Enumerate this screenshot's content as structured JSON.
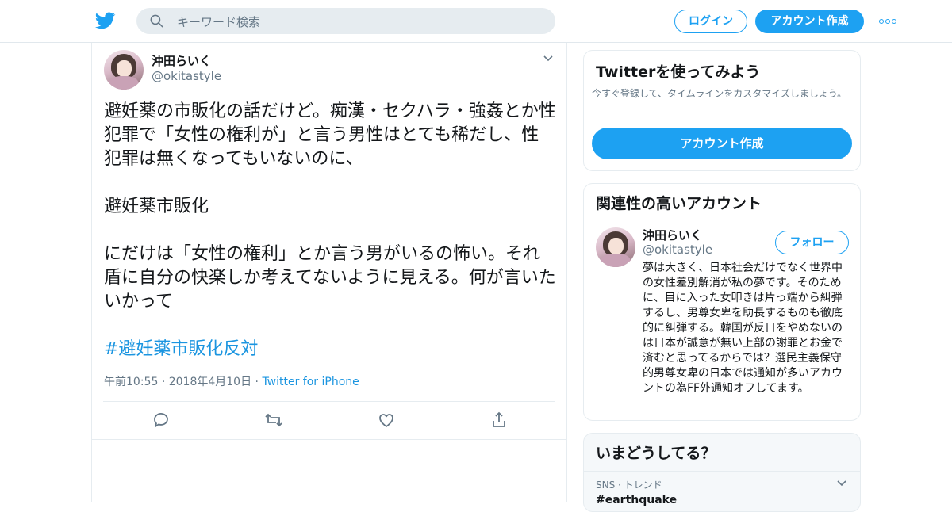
{
  "header": {
    "search_placeholder": "キーワード検索",
    "login_label": "ログイン",
    "signup_label": "アカウント作成"
  },
  "tweet": {
    "author_name": "沖田らいく",
    "author_handle": "@okitastyle",
    "text": "避妊薬の市販化の話だけど。痴漢・セクハラ・強姦とか性犯罪で「女性の権利が」と言う男性はとても稀だし、性犯罪は無くなってもいないのに、\n\n避妊薬市販化\n\nにだけは「女性の権利」とか言う男がいるの怖い。それ盾に自分の快楽しか考えてないように見える。何が言いたいかって",
    "hashtag": "#避妊薬市販化反対",
    "time": "午前10:55",
    "date": "2018年4月10日",
    "source": "Twitter for iPhone"
  },
  "sidebar": {
    "signup_card": {
      "title": "Twitterを使ってみよう",
      "subtitle": "今すぐ登録して、タイムラインをカスタマイズしましょう。",
      "cta_label": "アカウント作成"
    },
    "related_card": {
      "title": "関連性の高いアカウント",
      "name": "沖田らいく",
      "handle": "@okitastyle",
      "follow_label": "フォロー",
      "bio": "夢は大きく、日本社会だけでなく世界中の女性差別解消が私の夢です。そのために、目に入った女叩きは片っ端から糾弾するし、男尊女卑を助長するものも徹底的に糾弾する。韓国が反日をやめないのは日本が誠意が無い上部の謝罪とお金で済むと思ってるからでは？選民主義保守的男尊女卑の日本では通知が多いアカウントの為FF外通知オフしてます。"
    },
    "trends_card": {
      "title": "いまどうしてる？",
      "trend_category": "SNS · トレンド",
      "trend_name": "#earthquake"
    }
  },
  "colors": {
    "accent": "#1da1f2",
    "link": "#1b95e0",
    "secondary_text": "#657786"
  }
}
